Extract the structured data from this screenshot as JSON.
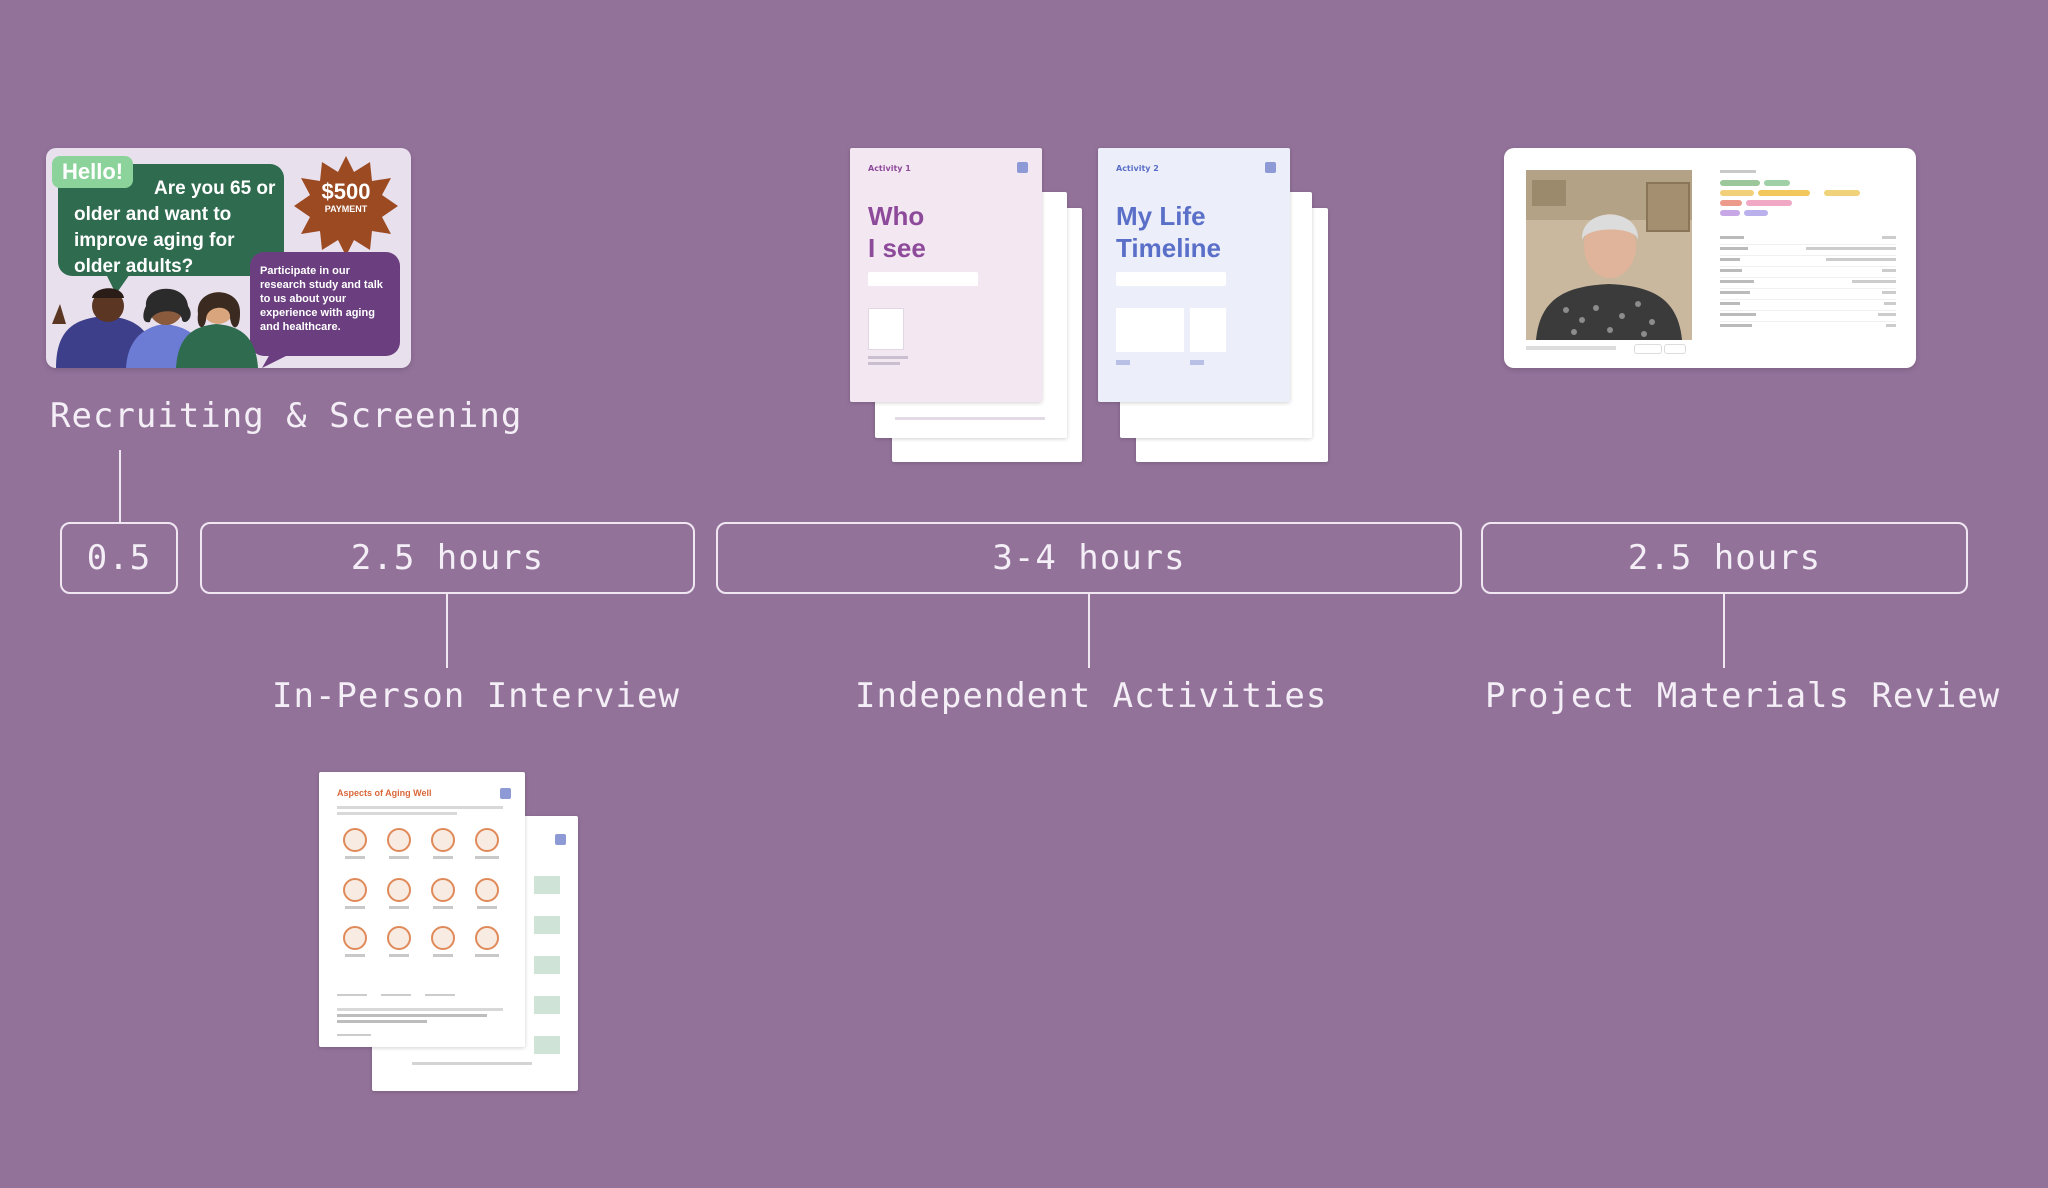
{
  "phases": {
    "recruiting": {
      "label": "Recruiting & Screening",
      "duration": "0.5"
    },
    "interview": {
      "label": "In-Person Interview",
      "duration": "2.5 hours"
    },
    "activities": {
      "label": "Independent Activities",
      "duration": "3-4 hours"
    },
    "review": {
      "label": "Project Materials Review",
      "duration": "2.5 hours"
    }
  },
  "flyer": {
    "hello": "Hello!",
    "question": "Are you 65 or older and want to improve aging for older adults?",
    "payment_amount": "$500",
    "payment_label": "PAYMENT",
    "invite": "Participate in our research study and talk to us about your experience with aging and healthcare."
  },
  "activity1": {
    "tag": "Activity 1",
    "title_line1": "Who",
    "title_line2": "I see"
  },
  "activity2": {
    "tag": "Activity 2",
    "title_line1": "My Life",
    "title_line2": "Timeline"
  },
  "interview_sheet": {
    "title": "Aspects of Aging Well"
  },
  "colors": {
    "background": "#93729a",
    "line": "#f0e7f2",
    "flyer_green": "#2f6b4f",
    "flyer_purple": "#6b3f7f",
    "payment_burst": "#9b4a22",
    "activity1_title": "#8e4a9a",
    "activity2_title": "#5a6fc8",
    "sheet_title_orange": "#d9683a"
  }
}
